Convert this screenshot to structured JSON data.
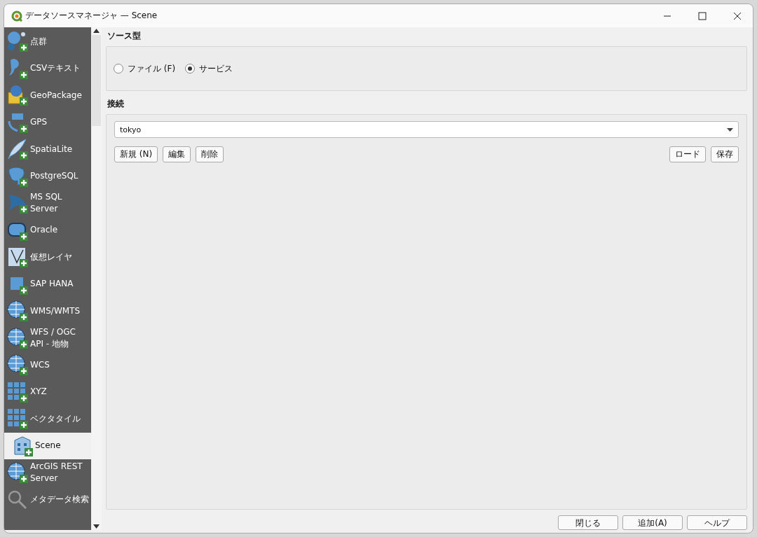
{
  "window": {
    "title": "データソースマネージャ — Scene"
  },
  "sidebar": {
    "items": [
      {
        "label": "点群",
        "kind": "dots",
        "selected": false
      },
      {
        "label": "CSVテキスト",
        "kind": "comma",
        "selected": false
      },
      {
        "label": "GeoPackage",
        "kind": "box",
        "selected": false
      },
      {
        "label": "GPS",
        "kind": "gps",
        "selected": false
      },
      {
        "label": "SpatiaLite",
        "kind": "feather",
        "selected": false
      },
      {
        "label": "PostgreSQL",
        "kind": "elephant",
        "selected": false
      },
      {
        "label": "MS SQL Server",
        "kind": "sail",
        "selected": false
      },
      {
        "label": "Oracle",
        "kind": "rounded",
        "selected": false
      },
      {
        "label": "仮想レイヤ",
        "kind": "vee",
        "selected": false
      },
      {
        "label": "SAP HANA",
        "kind": "square",
        "selected": false
      },
      {
        "label": "WMS/WMTS",
        "kind": "globe",
        "selected": false
      },
      {
        "label": "WFS / OGC API - 地物",
        "kind": "globe",
        "selected": false
      },
      {
        "label": "WCS",
        "kind": "globe",
        "selected": false
      },
      {
        "label": "XYZ",
        "kind": "grid",
        "selected": false
      },
      {
        "label": "ベクタタイル",
        "kind": "grid",
        "selected": false
      },
      {
        "label": "Scene",
        "kind": "building",
        "selected": true
      },
      {
        "label": "ArcGIS REST Server",
        "kind": "globe",
        "selected": false
      },
      {
        "label": "メタデータ検索",
        "kind": "search",
        "selected": false
      }
    ]
  },
  "source_type": {
    "title": "ソース型",
    "options": [
      {
        "label": "ファイル (F)",
        "selected": false
      },
      {
        "label": "サービス",
        "selected": true
      }
    ]
  },
  "connection": {
    "title": "接続",
    "value": "tokyo",
    "left_buttons": [
      "新規 (N)",
      "編集",
      "削除"
    ],
    "right_buttons": [
      "ロード",
      "保存"
    ]
  },
  "footer_buttons": [
    "閉じる",
    "追加(A)",
    "ヘルプ"
  ]
}
